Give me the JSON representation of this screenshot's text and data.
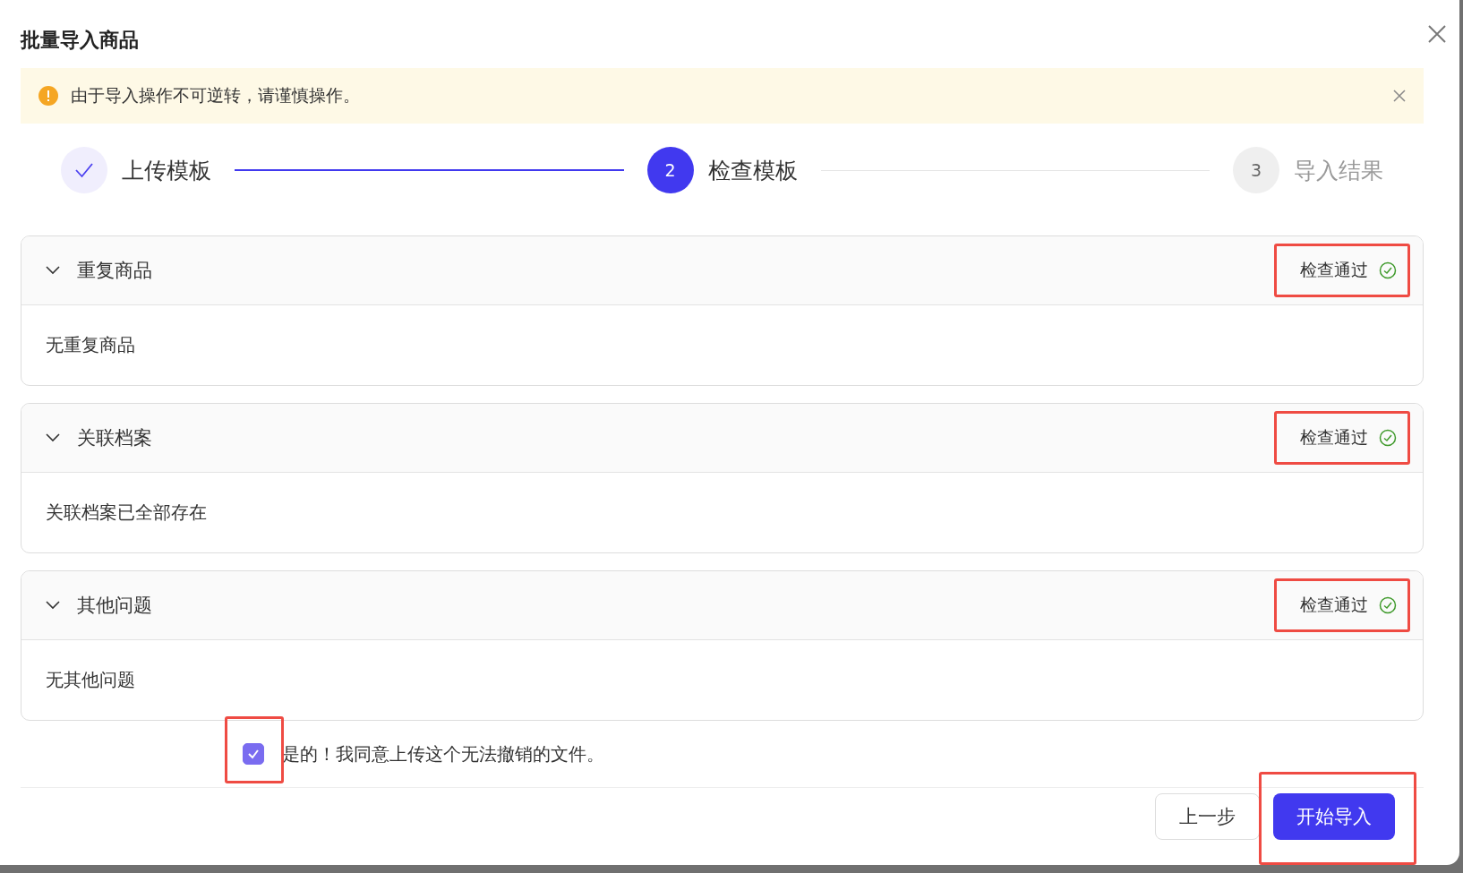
{
  "dialog": {
    "title": "批量导入商品"
  },
  "alert": {
    "text": "由于导入操作不可逆转，请谨慎操作。"
  },
  "steps": [
    {
      "label": "上传模板",
      "done": true,
      "selected": false
    },
    {
      "label": "检查模板",
      "number": "2",
      "done": false,
      "selected": true
    },
    {
      "label": "导入结果",
      "number": "3",
      "done": false,
      "selected": false
    }
  ],
  "sections": [
    {
      "title": "重复商品",
      "expanded": true,
      "status": "检查通过",
      "highlighted": true,
      "body": "无重复商品"
    },
    {
      "title": "关联档案",
      "expanded": true,
      "status": "检查通过",
      "highlighted": true,
      "body": "关联档案已全部存在"
    },
    {
      "title": "其他问题",
      "expanded": true,
      "status": "检查通过",
      "highlighted": true,
      "body": "无其他问题"
    }
  ],
  "agreement": {
    "label": "是的！我同意上传这个无法撤销的文件。",
    "checked": true,
    "highlighted": true
  },
  "buttons": [
    {
      "label": "上一步",
      "kind": "secondary",
      "highlighted": false
    },
    {
      "label": "开始导入",
      "kind": "primary",
      "highlighted": true
    }
  ]
}
